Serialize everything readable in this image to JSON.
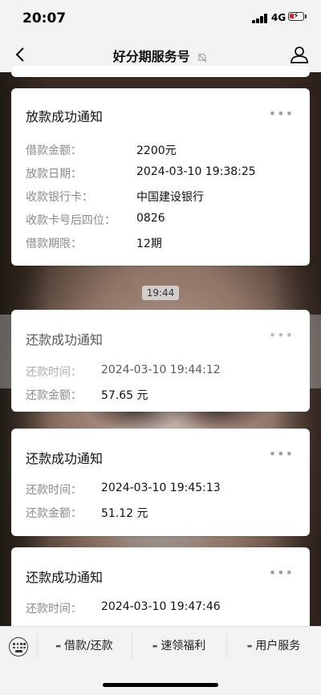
{
  "status_bar": {
    "time": "20:07",
    "network": "4G"
  },
  "nav": {
    "title": "好分期服务号"
  },
  "cards": [
    {
      "title": "放款成功通知",
      "rows": [
        {
          "label": "借款金额：",
          "value": "2200元"
        },
        {
          "label": "放款日期：",
          "value": "2024-03-10 19:38:25"
        },
        {
          "label": "收款银行卡：",
          "value": "中国建设银行"
        },
        {
          "label": "收款卡号后四位：",
          "value": "0826"
        },
        {
          "label": "借款期限：",
          "value": "12期"
        }
      ]
    },
    {
      "title": "还款成功通知",
      "rows": [
        {
          "label": "还款时间：",
          "value": "2024-03-10 19:44:12"
        },
        {
          "label": "还款金额：",
          "value": "57.65 元"
        }
      ]
    },
    {
      "title": "还款成功通知",
      "rows": [
        {
          "label": "还款时间：",
          "value": "2024-03-10 19:45:13"
        },
        {
          "label": "还款金额：",
          "value": "51.12 元"
        }
      ]
    },
    {
      "title": "还款成功通知",
      "rows": [
        {
          "label": "还款时间：",
          "value": "2024-03-10 19:47:46"
        }
      ]
    }
  ],
  "timestamp_divider": "19:44",
  "more_glyph": "•••",
  "bottom_menu": [
    {
      "label": "借款/还款"
    },
    {
      "label": "速领福利"
    },
    {
      "label": "用户服务"
    }
  ],
  "icons": {
    "back": "chevron-left-icon",
    "mute": "bell-off-icon",
    "profile": "person-icon",
    "keyboard": "keyboard-icon"
  },
  "colors": {
    "battery_low": "#e0202a"
  }
}
